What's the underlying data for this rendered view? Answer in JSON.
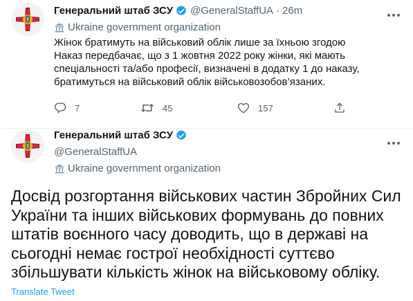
{
  "tweet1": {
    "display_name": "Генеральний штаб ЗСУ",
    "handle": "@GeneralStaffUA",
    "separator": "·",
    "time": "26m",
    "label": "Ukraine government organization",
    "text_lines": [
      "Жінок братимуть на військовий облік лише за їхньою згодою",
      "Наказ передбачає, що з 1 жовтня 2022 року жінки, які мають",
      "спеціальності та/або професії, визначені в додатку 1 до наказу,",
      "братимуться на військовий облік військовозобов’язаних."
    ],
    "actions": {
      "reply_count": "7",
      "retweet_count": "45",
      "like_count": "157"
    }
  },
  "tweet2": {
    "display_name": "Генеральний штаб ЗСУ",
    "handle": "@GeneralStaffUA",
    "label": "Ukraine government organization",
    "text_lines": [
      "Досвід розгортання військових частин Збройних Сил",
      "України та інших військових формувань до повних",
      "штатів воєнного часу доводить, що в державі на",
      "сьогодні немає гострої необхідності суттєво",
      "збільшувати кількість жінок на військовому обліку."
    ],
    "translate_label": "Translate Tweet"
  },
  "colors": {
    "verified": "#1d9bf0",
    "gov_badge": "#829aab",
    "avatar_emblem": "#b3122a",
    "avatar_gold": "#e0b31a"
  }
}
